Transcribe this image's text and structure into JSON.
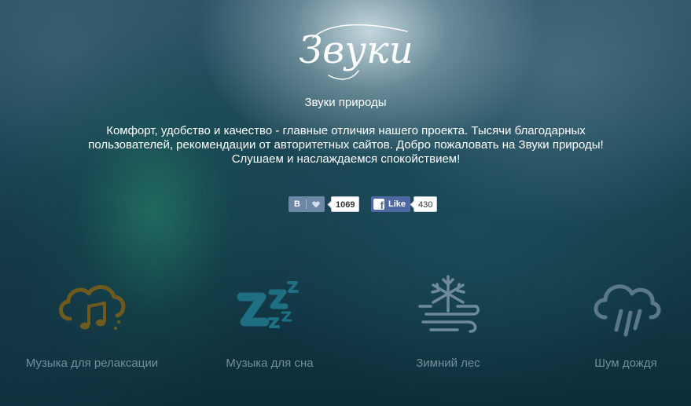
{
  "logo": {
    "text": "Звуки",
    "icon": "script-logo"
  },
  "site_title": "Звуки природы",
  "intro": [
    "Комфорт, удобство и качество - главные отличия нашего проекта. Тысячи благодарных",
    "пользователей, рекомендации от авторитетных сайтов. Добро пожаловать на Звуки природы!",
    "Слушаем и наслаждаемся спокойствием!"
  ],
  "social": {
    "vk": {
      "label": "В",
      "icon": "heart-icon",
      "count": "1069",
      "color": "#6d87a6"
    },
    "fb": {
      "label": "Like",
      "icon": "facebook-icon",
      "count": "430",
      "color": "#4e69a2"
    }
  },
  "categories": [
    {
      "label": "Музыка для релаксации",
      "icon": "cloud-music-icon",
      "color": "#6e5a1e"
    },
    {
      "label": "Музыка для сна",
      "icon": "sleep-zzz-icon",
      "color": "#1f6f82"
    },
    {
      "label": "Зимний лес",
      "icon": "snow-wind-icon",
      "color": "#6f8a98"
    },
    {
      "label": "Шум дождя",
      "icon": "rain-cloud-icon",
      "color": "#5a7888"
    }
  ]
}
